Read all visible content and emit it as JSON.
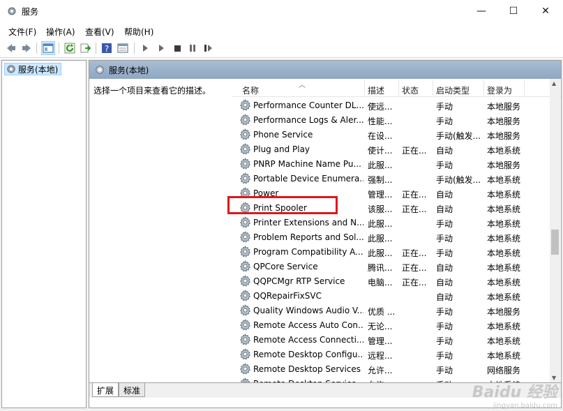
{
  "window": {
    "title": "服务",
    "minimize": "—",
    "maximize": "☐",
    "close": "✕"
  },
  "menu": [
    "文件(F)",
    "操作(A)",
    "查看(V)",
    "帮助(H)"
  ],
  "toolbar_icons": [
    "back-icon",
    "forward-icon",
    "console-tree-icon",
    "refresh-icon",
    "export-icon",
    "help-icon",
    "properties-icon",
    "start-icon",
    "start-alt-icon",
    "stop-icon",
    "pause-icon",
    "restart-icon"
  ],
  "tree": {
    "root_label": "服务(本地)"
  },
  "pane": {
    "header": "服务(本地)",
    "description": "选择一个项目来查看它的描述。"
  },
  "columns": {
    "name": "名称",
    "desc": "描述",
    "status": "状态",
    "startup": "启动类型",
    "logon": "登录为"
  },
  "services": [
    {
      "name": "Performance Counter DL...",
      "desc": "使远...",
      "status": "",
      "startup": "手动",
      "logon": "本地服务"
    },
    {
      "name": "Performance Logs & Aler...",
      "desc": "性能...",
      "status": "",
      "startup": "手动",
      "logon": "本地服务"
    },
    {
      "name": "Phone Service",
      "desc": "在设...",
      "status": "",
      "startup": "手动(触发...",
      "logon": "本地服务"
    },
    {
      "name": "Plug and Play",
      "desc": "使计...",
      "status": "正在...",
      "startup": "自动",
      "logon": "本地系统"
    },
    {
      "name": "PNRP Machine Name Pu...",
      "desc": "此服...",
      "status": "",
      "startup": "手动",
      "logon": "本地服务"
    },
    {
      "name": "Portable Device Enumera...",
      "desc": "强制...",
      "status": "",
      "startup": "手动(触发...",
      "logon": "本地系统"
    },
    {
      "name": "Power",
      "desc": "管理...",
      "status": "正在...",
      "startup": "自动",
      "logon": "本地系统"
    },
    {
      "name": "Print Spooler",
      "desc": "该服...",
      "status": "正在...",
      "startup": "自动",
      "logon": "本地系统"
    },
    {
      "name": "Printer Extensions and N...",
      "desc": "此服...",
      "status": "",
      "startup": "手动",
      "logon": "本地系统"
    },
    {
      "name": "Problem Reports and Sol...",
      "desc": "此服...",
      "status": "",
      "startup": "手动",
      "logon": "本地系统"
    },
    {
      "name": "Program Compatibility A...",
      "desc": "此服...",
      "status": "正在...",
      "startup": "手动",
      "logon": "本地系统"
    },
    {
      "name": "QPCore Service",
      "desc": "腾讯...",
      "status": "正在...",
      "startup": "自动",
      "logon": "本地系统"
    },
    {
      "name": "QQPCMgr RTP Service",
      "desc": "电脑...",
      "status": "正在...",
      "startup": "自动",
      "logon": "本地系统"
    },
    {
      "name": "QQRepairFixSVC",
      "desc": "",
      "status": "",
      "startup": "自动",
      "logon": "本地系统"
    },
    {
      "name": "Quality Windows Audio V...",
      "desc": "优质 ...",
      "status": "",
      "startup": "手动",
      "logon": "本地服务"
    },
    {
      "name": "Remote Access Auto Con...",
      "desc": "无论...",
      "status": "",
      "startup": "手动",
      "logon": "本地系统"
    },
    {
      "name": "Remote Access Connecti...",
      "desc": "管理...",
      "status": "",
      "startup": "手动",
      "logon": "本地系统"
    },
    {
      "name": "Remote Desktop Configu...",
      "desc": "远程...",
      "status": "",
      "startup": "手动",
      "logon": "本地系统"
    },
    {
      "name": "Remote Desktop Services",
      "desc": "允许...",
      "status": "",
      "startup": "手动",
      "logon": "网络服务"
    },
    {
      "name": "Remote Desktop Service...",
      "desc": "允许...",
      "status": "",
      "startup": "手动",
      "logon": "本地系统"
    }
  ],
  "tabs": [
    "扩展",
    "标准"
  ],
  "watermark": {
    "logo": "Baidu 经验",
    "url": "jingyan.baidu.com"
  }
}
